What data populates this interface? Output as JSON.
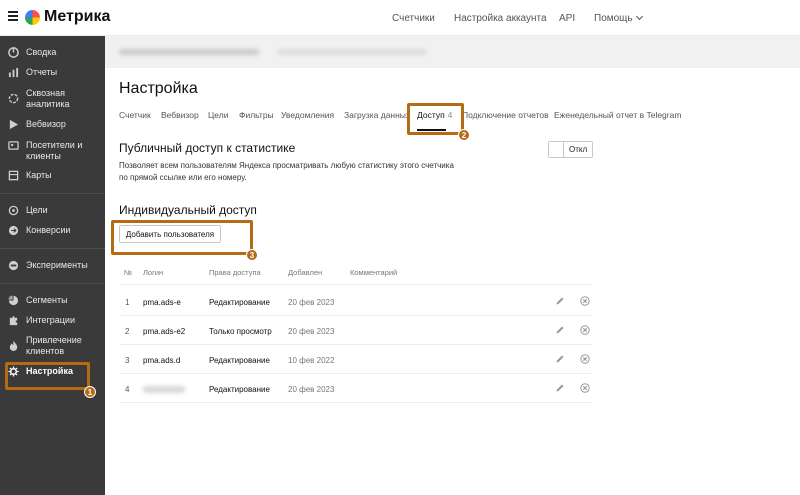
{
  "app": {
    "name": "Метрика"
  },
  "topnav": {
    "items": [
      "Счетчики",
      "Настройка аккаунта",
      "API",
      "Помощь"
    ]
  },
  "sidebar": {
    "items": [
      {
        "label": "Сводка",
        "icon": "grid-icon"
      },
      {
        "label": "Отчеты",
        "icon": "bar-chart-icon"
      },
      {
        "label": "Сквозная аналитика",
        "icon": "funnel-icon"
      },
      {
        "label": "Вебвизор",
        "icon": "play-icon"
      },
      {
        "label": "Посетители и клиенты",
        "icon": "people-icon"
      },
      {
        "label": "Карты",
        "icon": "map-icon"
      },
      {
        "label": "Цели",
        "icon": "target-icon"
      },
      {
        "label": "Конверсии",
        "icon": "conversion-icon"
      },
      {
        "label": "Эксперименты",
        "icon": "experiment-icon"
      },
      {
        "label": "Сегменты",
        "icon": "pie-icon"
      },
      {
        "label": "Интеграции",
        "icon": "puzzle-icon"
      },
      {
        "label": "Привлечение клиентов",
        "icon": "flame-icon"
      },
      {
        "label": "Настройка",
        "icon": "gear-icon"
      }
    ],
    "active": "Настройка"
  },
  "page": {
    "title": "Настройка"
  },
  "tabs": [
    {
      "label": "Счетчик"
    },
    {
      "label": "Вебвизор"
    },
    {
      "label": "Цели"
    },
    {
      "label": "Фильтры"
    },
    {
      "label": "Уведомления"
    },
    {
      "label": "Загрузка данных"
    },
    {
      "label": "Доступ",
      "count": "4"
    },
    {
      "label": "Подключение отчетов"
    },
    {
      "label": "Еженедельный отчет в Telegram"
    }
  ],
  "public_access": {
    "title": "Публичный доступ к статистике",
    "description": "Позволяет всем пользователям Яндекса просматривать любую статистику этого счетчика по прямой ссылке или его номеру.",
    "toggle_label": "Откл"
  },
  "individual_access": {
    "title": "Индивидуальный доступ",
    "add_button": "Добавить пользователя"
  },
  "table": {
    "columns": [
      "№",
      "Логин",
      "Права доступа",
      "Добавлен",
      "Комментарий"
    ],
    "rows": [
      {
        "num": "1",
        "login": "pma.ads-e",
        "rights": "Редактирование",
        "added": "20 фев 2023",
        "comment": ""
      },
      {
        "num": "2",
        "login": "pma.ads-e2",
        "rights": "Только просмотр",
        "added": "20 фев 2023",
        "comment": ""
      },
      {
        "num": "3",
        "login": "pma.ads.d",
        "rights": "Редактирование",
        "added": "10 фев 2022",
        "comment": ""
      },
      {
        "num": "4",
        "login": "",
        "rights": "Редактирование",
        "added": "20 фев 2023",
        "comment": ""
      }
    ]
  },
  "annotations": [
    "1",
    "2",
    "3"
  ],
  "colors": {
    "sidebar_bg": "#3a3a3a",
    "annotation": "#b56a14",
    "active_tab": "#111111"
  }
}
